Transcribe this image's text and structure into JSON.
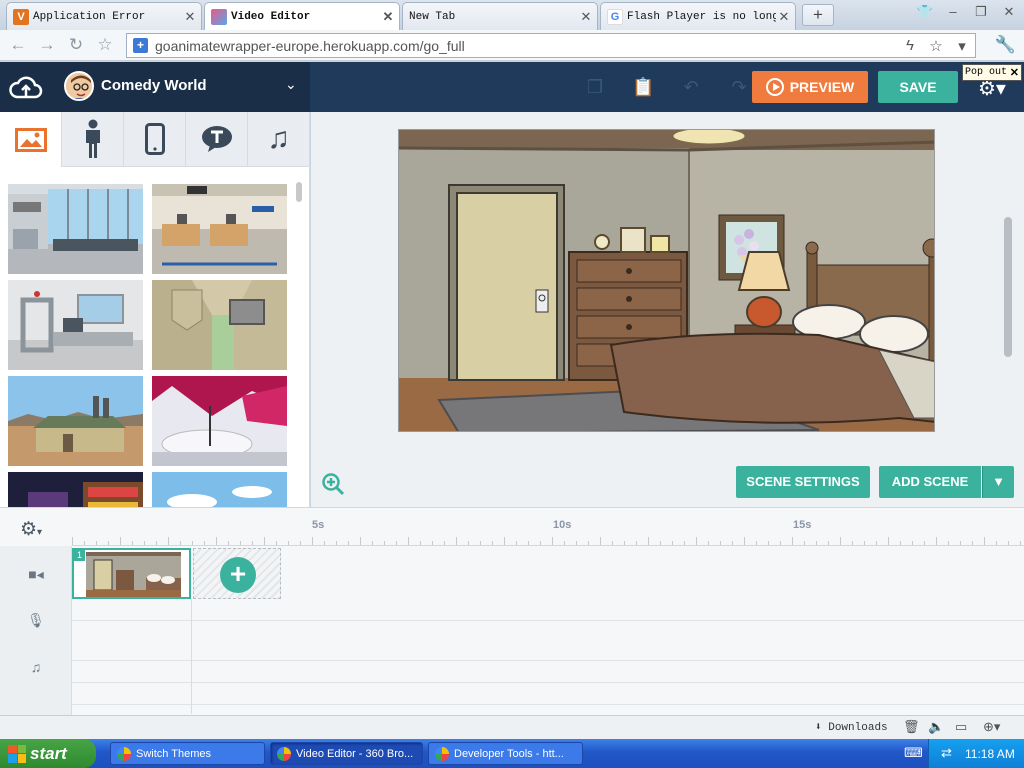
{
  "browser": {
    "tabs": [
      {
        "label": "Application Error",
        "favicon": "V",
        "favicon_color": "#e2741f",
        "active": false
      },
      {
        "label": "Video Editor",
        "favicon": "",
        "favicon_color": "#e85a8a",
        "active": true
      },
      {
        "label": "New Tab",
        "favicon": "",
        "favicon_color": "",
        "active": false
      },
      {
        "label": "Flash Player is no longer",
        "favicon": "G",
        "favicon_color": "#4285f4",
        "active": false
      }
    ],
    "new_tab_label": "+",
    "url": "goanimatewrapper-europe.herokuapp.com/go_full",
    "popout_label": "Pop out"
  },
  "editor": {
    "theme_name": "Comedy World",
    "preview_label": "PREVIEW",
    "save_label": "SAVE",
    "asset_tabs": [
      "backgrounds",
      "characters",
      "props",
      "text",
      "sounds"
    ],
    "active_asset_tab": "backgrounds",
    "scene_settings_label": "SCENE SETTINGS",
    "add_scene_label": "ADD SCENE",
    "accent_color": "#3ab29e",
    "preview_color": "#f07b3f",
    "header_color": "#1f3a5a"
  },
  "timeline": {
    "ruler_labels": [
      "5s",
      "10s",
      "15s"
    ],
    "scene_number": "1",
    "tracks": [
      "video",
      "voice",
      "music"
    ]
  },
  "statusbar": {
    "downloads_label": "Downloads"
  },
  "taskbar": {
    "start_label": "start",
    "tasks": [
      "Switch Themes",
      "Video Editor - 360 Bro...",
      "Developer Tools - htt..."
    ],
    "clock": "11:18 AM"
  }
}
